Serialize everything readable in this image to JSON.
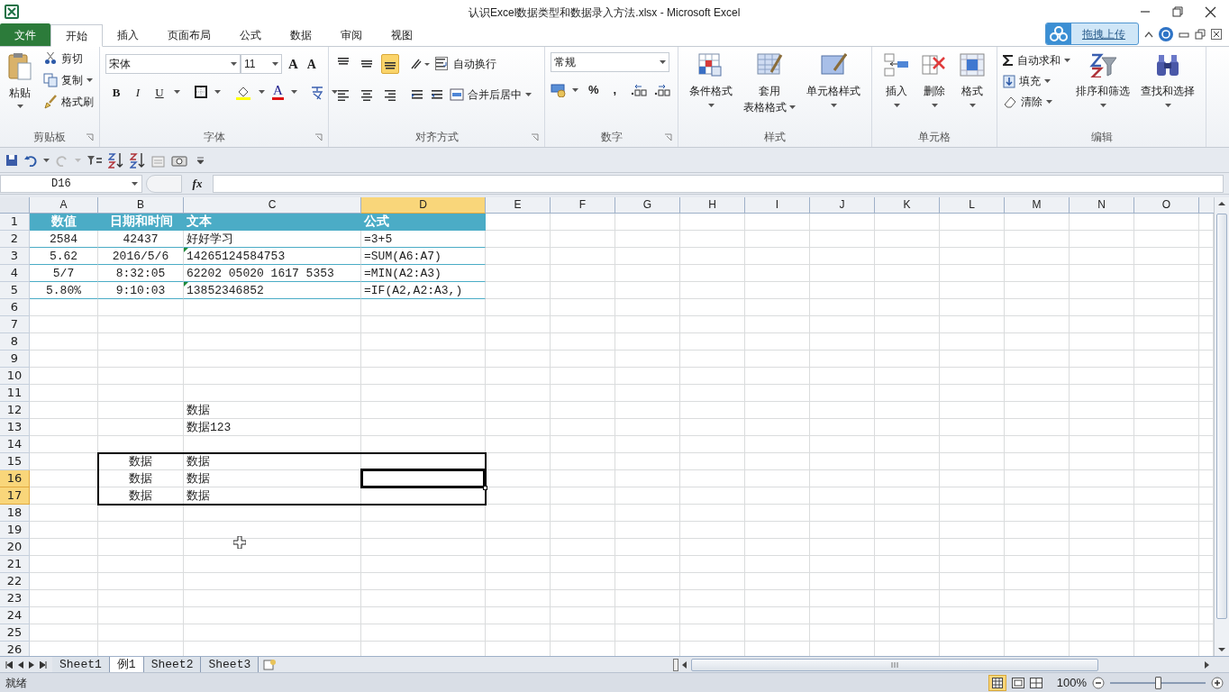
{
  "title_bar": {
    "title": "认识Excel数据类型和数据录入方法.xlsx  -  Microsoft Excel"
  },
  "ribbon_tabs": [
    {
      "label": "文件",
      "kind": "file",
      "selected": false
    },
    {
      "label": "开始",
      "kind": "tab",
      "selected": true
    },
    {
      "label": "插入",
      "kind": "tab",
      "selected": false
    },
    {
      "label": "页面布局",
      "kind": "tab",
      "selected": false
    },
    {
      "label": "公式",
      "kind": "tab",
      "selected": false
    },
    {
      "label": "数据",
      "kind": "tab",
      "selected": false
    },
    {
      "label": "审阅",
      "kind": "tab",
      "selected": false
    },
    {
      "label": "视图",
      "kind": "tab",
      "selected": false
    }
  ],
  "upload_button": {
    "label": "拖拽上传"
  },
  "ribbon_groups": [
    {
      "kind": "clipboard",
      "label": "剪贴板",
      "launcher": true,
      "paste": "粘贴",
      "items": [
        "剪切",
        "复制",
        "格式刷"
      ]
    },
    {
      "kind": "font",
      "label": "字体",
      "launcher": true,
      "font_name": "宋体",
      "font_size": "11",
      "size_buttons": [
        "A",
        "A"
      ],
      "styles": [
        "B",
        "I",
        "U"
      ],
      "font_color_glyph": "A"
    },
    {
      "kind": "alignment",
      "label": "对齐方式",
      "launcher": true,
      "vertical": [
        {
          "selected": false
        },
        {
          "selected": false
        },
        {
          "selected": true
        }
      ],
      "wrap": "自动换行",
      "merge": "合并后居中"
    },
    {
      "kind": "number",
      "label": "数字",
      "launcher": true,
      "format": "常规",
      "symbols": [
        "%",
        ","
      ]
    },
    {
      "kind": "styles",
      "label": "样式",
      "launcher": false,
      "buttons": [
        {
          "lines": [
            "条件格式"
          ]
        },
        {
          "lines": [
            "套用",
            "表格格式"
          ]
        },
        {
          "lines": [
            "单元格样式"
          ]
        }
      ]
    },
    {
      "kind": "cells",
      "label": "单元格",
      "launcher": false,
      "buttons": [
        {
          "lines": [
            "插入"
          ]
        },
        {
          "lines": [
            "删除"
          ]
        },
        {
          "lines": [
            "格式"
          ]
        }
      ]
    },
    {
      "kind": "editing",
      "label": "编辑",
      "launcher": false,
      "items": [
        "自动求和",
        "填充",
        "清除"
      ],
      "buttons": [
        {
          "lines": [
            "排序和筛选"
          ]
        },
        {
          "lines": [
            "查找和选择"
          ]
        }
      ]
    }
  ],
  "formula_bar": {
    "name_box": "D16",
    "fx": "fx"
  },
  "columns": [
    {
      "letter": "A",
      "selected": false
    },
    {
      "letter": "B",
      "selected": false
    },
    {
      "letter": "C",
      "selected": false
    },
    {
      "letter": "D",
      "selected": true
    },
    {
      "letter": "E",
      "selected": false
    },
    {
      "letter": "F",
      "selected": false
    },
    {
      "letter": "G",
      "selected": false
    },
    {
      "letter": "H",
      "selected": false
    },
    {
      "letter": "I",
      "selected": false
    },
    {
      "letter": "J",
      "selected": false
    },
    {
      "letter": "K",
      "selected": false
    },
    {
      "letter": "L",
      "selected": false
    },
    {
      "letter": "M",
      "selected": false
    },
    {
      "letter": "N",
      "selected": false
    },
    {
      "letter": "O",
      "selected": false
    }
  ],
  "rows": [
    {
      "number": "1",
      "kind": "header",
      "selected": false,
      "boxed": false,
      "cells": {
        "A": {
          "text": "数值"
        },
        "B": {
          "text": "日期和时间"
        },
        "C": {
          "text": "文本"
        },
        "D": {
          "text": "公式"
        }
      }
    },
    {
      "number": "2",
      "kind": "banded",
      "selected": false,
      "boxed": false,
      "cells": {
        "A": {
          "text": "2584"
        },
        "B": {
          "text": "42437"
        },
        "C": {
          "text": "好好学习"
        },
        "D": {
          "text": "=3+5"
        }
      }
    },
    {
      "number": "3",
      "kind": "banded",
      "selected": false,
      "boxed": false,
      "cells": {
        "A": {
          "text": "5.62"
        },
        "B": {
          "text": "2016/5/6"
        },
        "C": {
          "text": "14265124584753",
          "error_mark": true
        },
        "D": {
          "text": "=SUM(A6:A7)"
        }
      }
    },
    {
      "number": "4",
      "kind": "banded",
      "selected": false,
      "boxed": false,
      "cells": {
        "A": {
          "text": "5/7"
        },
        "B": {
          "text": "8:32:05"
        },
        "C": {
          "text": "62202 05020 1617 5353"
        },
        "D": {
          "text": "=MIN(A2:A3)"
        }
      }
    },
    {
      "number": "5",
      "kind": "banded",
      "selected": false,
      "boxed": false,
      "cells": {
        "A": {
          "text": "5.80%"
        },
        "B": {
          "text": "9:10:03"
        },
        "C": {
          "text": "13852346852",
          "error_mark": true
        },
        "D": {
          "text": "=IF(A2,A2:A3,)"
        }
      }
    },
    {
      "number": "6",
      "kind": "plain",
      "selected": false,
      "boxed": false
    },
    {
      "number": "7",
      "kind": "plain",
      "selected": false,
      "boxed": false
    },
    {
      "number": "8",
      "kind": "plain",
      "selected": false,
      "boxed": false
    },
    {
      "number": "9",
      "kind": "plain",
      "selected": false,
      "boxed": false
    },
    {
      "number": "10",
      "kind": "plain",
      "selected": false,
      "boxed": false
    },
    {
      "number": "11",
      "kind": "plain",
      "selected": false,
      "boxed": false
    },
    {
      "number": "12",
      "kind": "plain",
      "selected": false,
      "boxed": false,
      "cells": {
        "C": {
          "text": "数据"
        }
      }
    },
    {
      "number": "13",
      "kind": "plain",
      "selected": false,
      "boxed": false,
      "cells": {
        "C": {
          "text": "数据123"
        }
      }
    },
    {
      "number": "14",
      "kind": "plain",
      "selected": false,
      "boxed": false
    },
    {
      "number": "15",
      "kind": "plain",
      "selected": false,
      "boxed": true,
      "cells": {
        "B": {
          "text": "数据"
        },
        "C": {
          "text": "数据"
        }
      }
    },
    {
      "number": "16",
      "kind": "plain",
      "selected": true,
      "boxed": true,
      "active": true,
      "cells": {
        "B": {
          "text": "数据"
        },
        "C": {
          "text": "数据"
        }
      }
    },
    {
      "number": "17",
      "kind": "plain",
      "selected": true,
      "boxed": true,
      "cells": {
        "B": {
          "text": "数据"
        },
        "C": {
          "text": "数据"
        }
      }
    },
    {
      "number": "18",
      "kind": "plain",
      "selected": false,
      "boxed": false
    },
    {
      "number": "19",
      "kind": "plain",
      "selected": false,
      "boxed": false
    },
    {
      "number": "20",
      "kind": "plain",
      "selected": false,
      "boxed": false
    },
    {
      "number": "21",
      "kind": "plain",
      "selected": false,
      "boxed": false
    },
    {
      "number": "22",
      "kind": "plain",
      "selected": false,
      "boxed": false
    },
    {
      "number": "23",
      "kind": "plain",
      "selected": false,
      "boxed": false
    },
    {
      "number": "24",
      "kind": "plain",
      "selected": false,
      "boxed": false
    },
    {
      "number": "25",
      "kind": "plain",
      "selected": false,
      "boxed": false
    },
    {
      "number": "26",
      "kind": "plain",
      "selected": false,
      "boxed": false
    }
  ],
  "sheet_tabs": [
    {
      "label": "Sheet1",
      "selected": false
    },
    {
      "label": "例1",
      "selected": true
    },
    {
      "label": "Sheet2",
      "selected": false
    },
    {
      "label": "Sheet3",
      "selected": false
    }
  ],
  "status_bar": {
    "status": "就绪",
    "zoom": "100%",
    "zoom_slider": {
      "level": 0.5
    }
  }
}
